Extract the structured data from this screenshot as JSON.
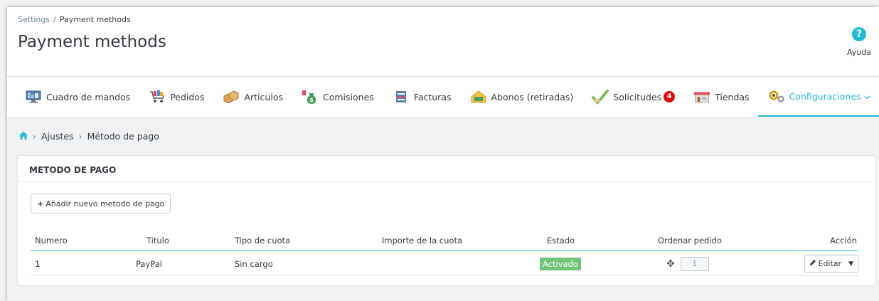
{
  "header": {
    "breadcrumb_parent": "Settings",
    "breadcrumb_sep": "/",
    "breadcrumb_current": "Payment methods",
    "title": "Payment methods",
    "help_label": "Ayuda",
    "help_icon": "?"
  },
  "tabs": [
    {
      "label": "Cuadro de mandos",
      "icon": "dashboard-icon"
    },
    {
      "label": "Pedidos",
      "icon": "cart-icon"
    },
    {
      "label": "Articulos",
      "icon": "boxes-icon"
    },
    {
      "label": "Comisiones",
      "icon": "money-bag-icon"
    },
    {
      "label": "Facturas",
      "icon": "invoice-icon"
    },
    {
      "label": "Abonos (retiradas)",
      "icon": "withdraw-icon"
    },
    {
      "label": "Solicitudes",
      "icon": "check-request-icon",
      "badge": "4"
    },
    {
      "label": "Tiendas",
      "icon": "store-icon"
    },
    {
      "label": "Configuraciones",
      "icon": "gears-icon",
      "active": true
    }
  ],
  "subcrumb": {
    "home_icon": "home-icon",
    "item1": "Ajustes",
    "item2": "Método de pago"
  },
  "panel": {
    "title": "METODO DE PAGO",
    "add_button": "Añadir nuevo metodo de pago",
    "columns": [
      "Numero",
      "Titulo",
      "Tipo de cuota",
      "Importe de la cuota",
      "Estado",
      "Ordenar pedido",
      "Acción"
    ],
    "rows": [
      {
        "numero": "1",
        "titulo": "PayPal",
        "tipo": "Sin cargo",
        "importe": "",
        "estado": "Activado",
        "orden": "1",
        "accion": "Editar"
      }
    ]
  },
  "colors": {
    "accent": "#25b9d7",
    "status_active": "#72c279",
    "badge": "#e40808"
  }
}
